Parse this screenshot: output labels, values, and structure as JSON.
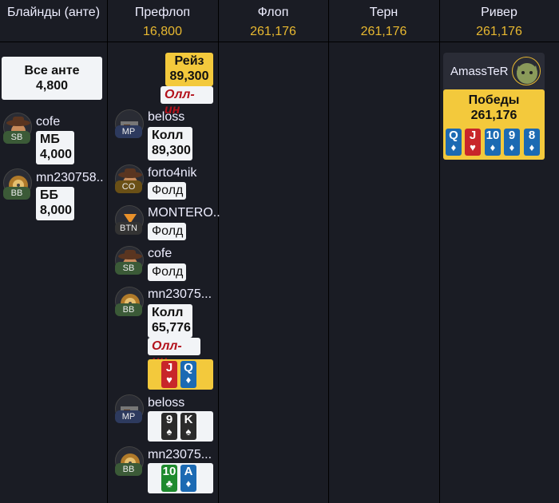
{
  "columns": [
    {
      "title": "Блайнды (анте)",
      "pot": ""
    },
    {
      "title": "Префлоп",
      "pot": "16,800"
    },
    {
      "title": "Флоп",
      "pot": "261,176"
    },
    {
      "title": "Терн",
      "pot": "261,176"
    },
    {
      "title": "Ривер",
      "pot": "261,176"
    }
  ],
  "blinds": {
    "ante_label": "Все анте",
    "ante_amount": "4,800",
    "players": [
      {
        "name": "cofe",
        "position": "SB",
        "action": "МБ",
        "amount": "4,000"
      },
      {
        "name": "mn230758..",
        "position": "BB",
        "action": "ББ",
        "amount": "8,000"
      }
    ]
  },
  "preflop": {
    "raise": {
      "action": "Рейз",
      "amount": "89,300",
      "allin": "Олл-ин"
    },
    "actions": [
      {
        "name": "beloss",
        "position": "MP",
        "action": "Колл",
        "amount": "89,300"
      },
      {
        "name": "forto4nik",
        "position": "CO",
        "action": "Фолд"
      },
      {
        "name": "MONTERO..",
        "position": "BTN",
        "action": "Фолд"
      },
      {
        "name": "cofe",
        "position": "SB",
        "action": "Фолд"
      },
      {
        "name": "mn23075...",
        "position": "BB",
        "action": "Колл",
        "amount": "65,776",
        "allin": "Олл-ин"
      }
    ],
    "hero_cards": [
      {
        "rank": "J",
        "suit": "♥"
      },
      {
        "rank": "Q",
        "suit": "♦"
      }
    ],
    "showdown": [
      {
        "name": "beloss",
        "position": "MP",
        "cards": [
          {
            "rank": "9",
            "suit": "♠"
          },
          {
            "rank": "K",
            "suit": "♠"
          }
        ]
      },
      {
        "name": "mn23075...",
        "position": "BB",
        "cards": [
          {
            "rank": "10",
            "suit": "♣"
          },
          {
            "rank": "A",
            "suit": "♦"
          }
        ]
      }
    ]
  },
  "river": {
    "winner": "AmassTeR",
    "result_label": "Победы",
    "result_amount": "261,176",
    "cards": [
      {
        "rank": "Q",
        "suit": "♦"
      },
      {
        "rank": "J",
        "suit": "♥"
      },
      {
        "rank": "10",
        "suit": "♦"
      },
      {
        "rank": "9",
        "suit": "♦"
      },
      {
        "rank": "8",
        "suit": "♦"
      }
    ]
  },
  "colors": {
    "accent": "#e8b830",
    "highlight": "#f3c93c",
    "allin": "#b3121c"
  }
}
